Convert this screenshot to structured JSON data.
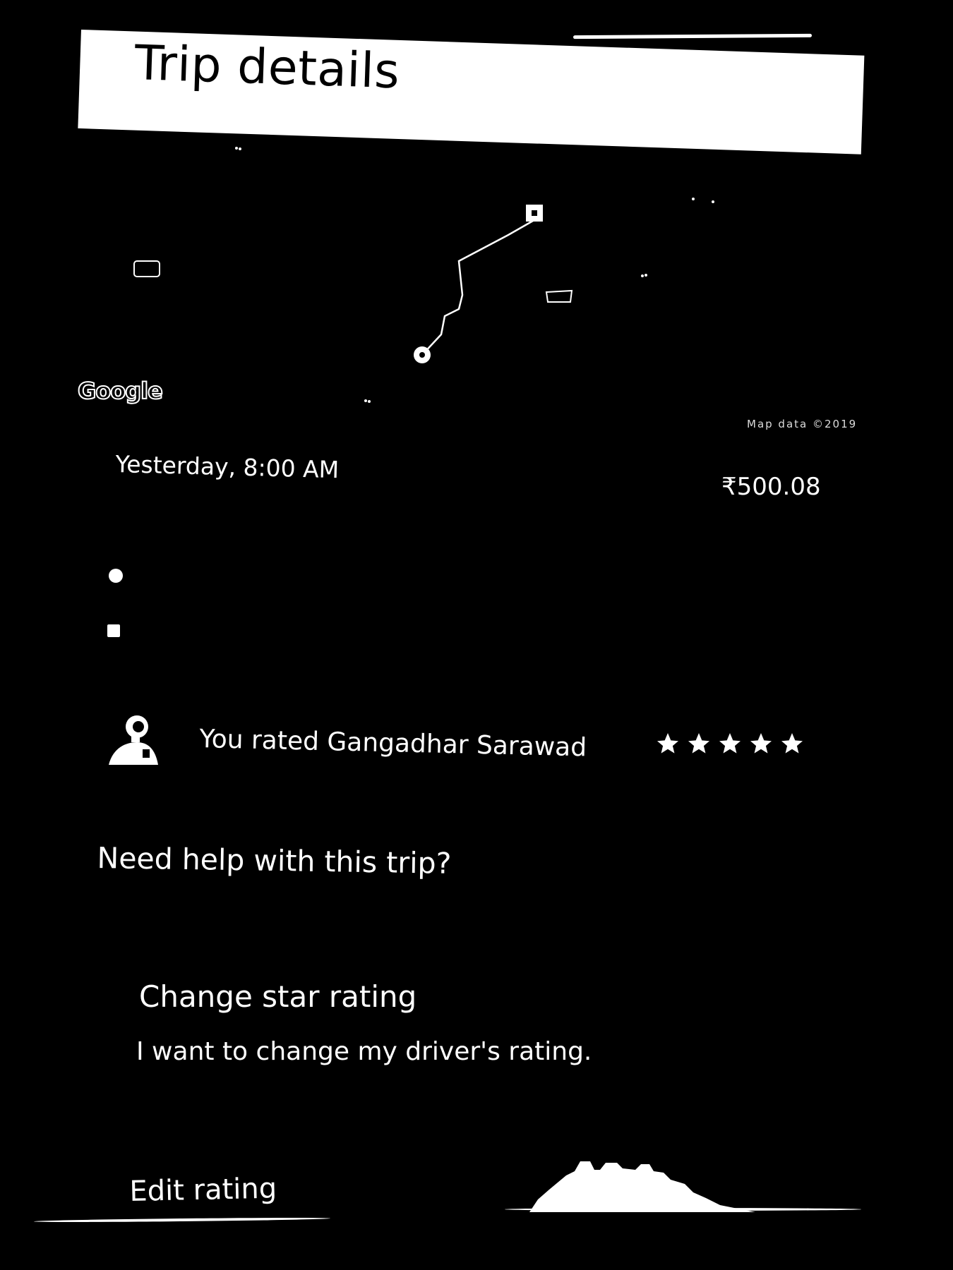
{
  "header": {
    "title": "Trip details"
  },
  "map": {
    "logo": "Google",
    "attribution": "Map data ©2019",
    "start_marker": "circle-marker-icon",
    "end_marker": "square-marker-icon"
  },
  "trip": {
    "time": "Yesterday, 8:00 AM",
    "price": "₹500.08",
    "pickup_icon": "circle-dot-icon",
    "dropoff_icon": "square-dot-icon"
  },
  "driver": {
    "rating_text": "You rated Gangadhar Sarawad",
    "stars": 5,
    "stars_max": 5,
    "avatar": "driver-avatar-photo"
  },
  "help": {
    "heading": "Need help with this trip?",
    "option_title": "Change star rating",
    "option_description": "I want to change my driver's rating.",
    "action_label": "Edit rating"
  }
}
